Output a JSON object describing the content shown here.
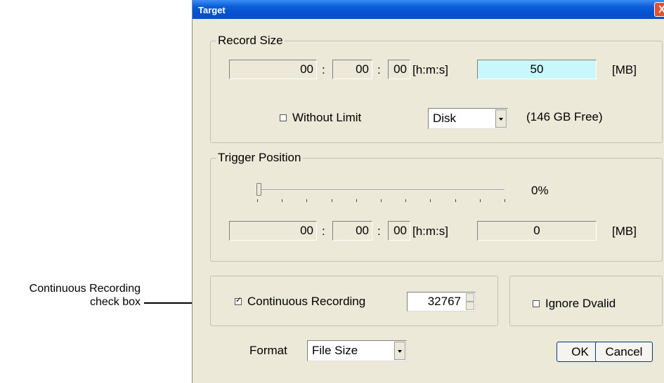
{
  "callout": {
    "text_line1": "Continuous Recording",
    "text_line2": "check box"
  },
  "window": {
    "title": "Target",
    "close_glyph": "X"
  },
  "record_size": {
    "legend": "Record Size",
    "hours": "00",
    "minutes": "00",
    "seconds": "00",
    "time_separator": ":",
    "time_unit": "[h:m:s]",
    "size_value": "50",
    "size_unit": "[MB]",
    "without_limit_label": "Without Limit",
    "without_limit_checked": false,
    "disk_select": "Disk",
    "free_space": "(146 GB Free)"
  },
  "trigger_position": {
    "legend": "Trigger Position",
    "slider_percent": 0,
    "percent_label": "0%",
    "hours": "00",
    "minutes": "00",
    "seconds": "00",
    "time_separator": ":",
    "time_unit": "[h:m:s]",
    "size_value": "0",
    "size_unit": "[MB]"
  },
  "continuous": {
    "label": "Continuous Recording",
    "checked": true,
    "spin_value": "32767"
  },
  "ignore_dvalid": {
    "label": "Ignore Dvalid",
    "checked": false
  },
  "format": {
    "label": "Format",
    "selected": "File Size"
  },
  "buttons": {
    "ok": "OK",
    "cancel": "Cancel"
  }
}
